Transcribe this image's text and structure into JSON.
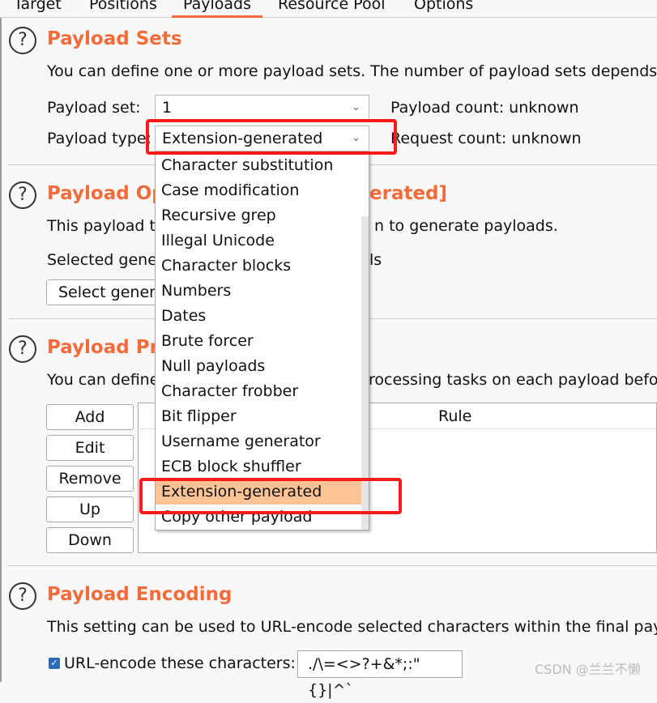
{
  "tabs": [
    {
      "label": "Target"
    },
    {
      "label": "Positions"
    },
    {
      "label": "Payloads",
      "active": true
    },
    {
      "label": "Resource Pool"
    },
    {
      "label": "Options"
    }
  ],
  "accent_color": "#f26b3a",
  "payload_sets": {
    "title": "Payload Sets",
    "description": "You can define one or more payload sets. The number of payload sets depends",
    "set_label": "Payload set:",
    "set_value": "1",
    "type_label": "Payload type:",
    "type_value": "Extension-generated",
    "payload_count": "Payload count: unknown",
    "request_count": "Request count: unknown"
  },
  "payload_options": {
    "title_left": "Payload Op",
    "title_right": "erated]",
    "desc_left": "This payload t",
    "desc_right": "n to generate payloads.",
    "selected_left": "Selected gene",
    "selected_right": "ls",
    "button_left": "Select genera"
  },
  "payload_processing": {
    "title_left": "Payload Pr",
    "desc_left": "You can define",
    "desc_right": "rocessing tasks on each payload befo",
    "buttons": [
      "Add",
      "Edit",
      "Remove",
      "Up",
      "Down"
    ],
    "column_header": "Rule"
  },
  "dropdown": {
    "items": [
      "Character substitution",
      "Case modification",
      "Recursive grep",
      "Illegal Unicode",
      "Character blocks",
      "Numbers",
      "Dates",
      "Brute forcer",
      "Null payloads",
      "Character frobber",
      "Bit flipper",
      "Username generator",
      "ECB block shuffler",
      "Extension-generated",
      "Copy other payload"
    ],
    "selected": "Extension-generated",
    "highlight_color": "#ffc496"
  },
  "payload_encoding": {
    "title": "Payload Encoding",
    "description": "This setting can be used to URL-encode selected characters within the final payl",
    "checkbox_label": "URL-encode these characters:",
    "checked": true,
    "characters": "./\\=<>?+&*;:\"{}|^`"
  },
  "watermark": "CSDN @兰兰不懒"
}
